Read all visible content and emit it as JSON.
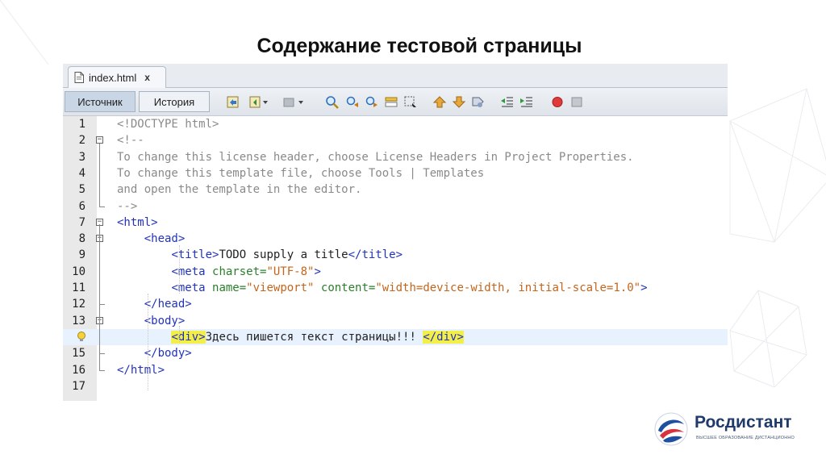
{
  "slide": {
    "title": "Содержание тестовой страницы"
  },
  "editor": {
    "file_tab": {
      "name": "index.html",
      "close": "x",
      "icon": "html-file-icon"
    },
    "view_tabs": {
      "source": "Источник",
      "history": "История"
    },
    "toolbar_icons": [
      "last-edit-icon",
      "back-icon",
      "forward-icon",
      "find-selection-icon",
      "find-previous-icon",
      "find-next-icon",
      "toggle-highlight-icon",
      "toggle-rectangular-selection-icon",
      "previous-bookmark-icon",
      "next-bookmark-icon",
      "toggle-bookmark-icon",
      "shift-left-icon",
      "shift-right-icon",
      "start-macro-icon",
      "stop-macro-icon"
    ],
    "lines": [
      {
        "n": "1",
        "segments": [
          {
            "t": "<!DOCTYPE html>",
            "c": "cmt"
          }
        ]
      },
      {
        "n": "2",
        "segments": [
          {
            "t": "<!--",
            "c": "cmt"
          }
        ]
      },
      {
        "n": "3",
        "segments": [
          {
            "t": "To change this license header, choose License Headers in Project Properties.",
            "c": "cmt"
          }
        ]
      },
      {
        "n": "4",
        "segments": [
          {
            "t": "To change this template file, choose Tools | Templates",
            "c": "cmt"
          }
        ]
      },
      {
        "n": "5",
        "segments": [
          {
            "t": "and open the template in the editor.",
            "c": "cmt"
          }
        ]
      },
      {
        "n": "6",
        "segments": [
          {
            "t": "-->",
            "c": "cmt"
          }
        ]
      },
      {
        "n": "7",
        "segments": [
          {
            "t": "<html>",
            "c": "tag"
          }
        ]
      },
      {
        "n": "8",
        "segments": [
          {
            "t": "    "
          },
          {
            "t": "<head>",
            "c": "tag"
          }
        ]
      },
      {
        "n": "9",
        "segments": [
          {
            "t": "        "
          },
          {
            "t": "<title>",
            "c": "tag"
          },
          {
            "t": "TODO supply a title",
            "c": "plain"
          },
          {
            "t": "</title>",
            "c": "tag"
          }
        ]
      },
      {
        "n": "10",
        "segments": [
          {
            "t": "        "
          },
          {
            "t": "<meta ",
            "c": "tag"
          },
          {
            "t": "charset=",
            "c": "attr"
          },
          {
            "t": "\"UTF-8\"",
            "c": "val"
          },
          {
            "t": ">",
            "c": "tag"
          }
        ]
      },
      {
        "n": "11",
        "segments": [
          {
            "t": "        "
          },
          {
            "t": "<meta ",
            "c": "tag"
          },
          {
            "t": "name=",
            "c": "attr"
          },
          {
            "t": "\"viewport\"",
            "c": "val"
          },
          {
            "t": " content=",
            "c": "attr"
          },
          {
            "t": "\"width=device-width, initial-scale=1.0\"",
            "c": "val"
          },
          {
            "t": ">",
            "c": "tag"
          }
        ]
      },
      {
        "n": "12",
        "segments": [
          {
            "t": "    "
          },
          {
            "t": "</head>",
            "c": "tag"
          }
        ]
      },
      {
        "n": "13",
        "segments": [
          {
            "t": "    "
          },
          {
            "t": "<body>",
            "c": "tag"
          }
        ]
      },
      {
        "n": "",
        "segments": [
          {
            "t": "        "
          },
          {
            "t": "<div>",
            "c": "tag yel"
          },
          {
            "t": "Здесь пишется текст страницы!!! ",
            "c": "plain"
          },
          {
            "t": "</div>",
            "c": "tag yel"
          }
        ]
      },
      {
        "n": "15",
        "segments": [
          {
            "t": "    "
          },
          {
            "t": "</body>",
            "c": "tag"
          }
        ]
      },
      {
        "n": "16",
        "segments": [
          {
            "t": "</html>",
            "c": "tag"
          }
        ]
      },
      {
        "n": "17",
        "segments": []
      }
    ]
  },
  "logo": {
    "name": "Росдистант",
    "tagline": "ВЫСШЕЕ ОБРАЗОВАНИЕ ДИСТАНЦИОННО"
  },
  "colors": {
    "tag": "#2233bb",
    "attribute": "#2a7f2a",
    "value": "#c4651b",
    "comment": "#8a8a8a",
    "match_highlight": "#f3ef48",
    "current_line": "#e8f2fe",
    "brand": "#1f3a6b"
  }
}
